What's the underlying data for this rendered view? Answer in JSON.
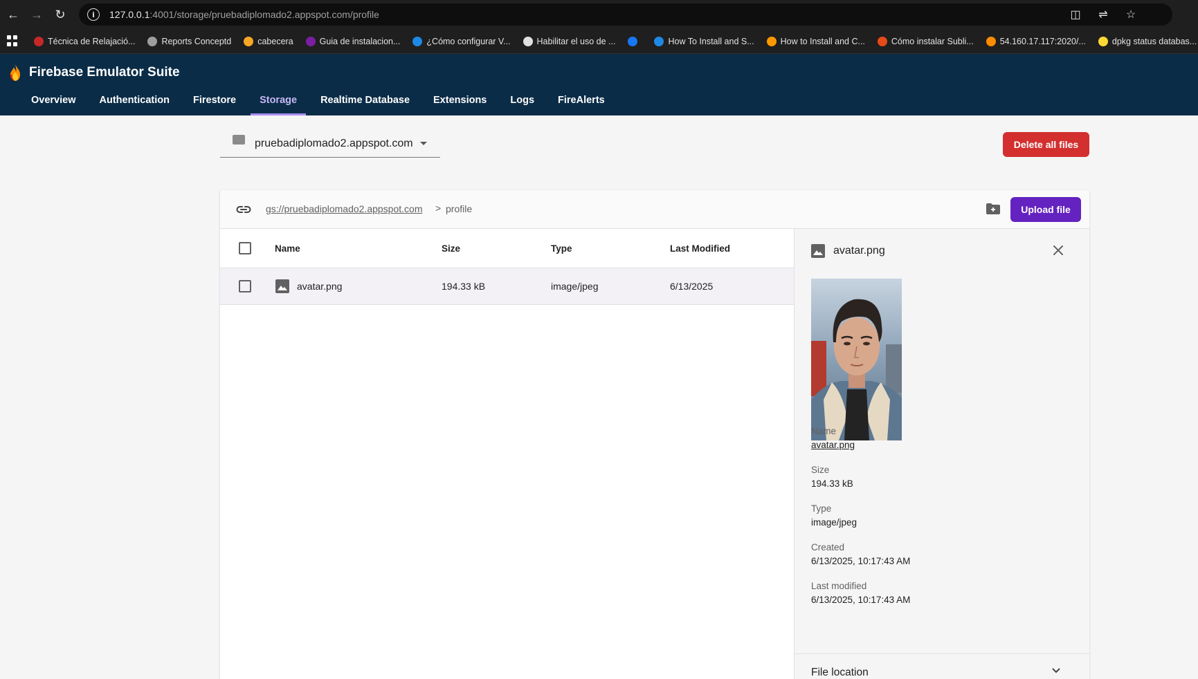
{
  "browser": {
    "url_host": "127.0.0.1",
    "url_rest": ":4001/storage/pruebadiplomado2.appspot.com/profile",
    "bookmarks": [
      {
        "label": "Técnica de Relajació...",
        "color": "#c62828"
      },
      {
        "label": "Reports Conceptd",
        "color": "#9e9e9e"
      },
      {
        "label": "cabecera",
        "color": "#f9a825"
      },
      {
        "label": "Guia de instalacion...",
        "color": "#7b1fa2"
      },
      {
        "label": "¿Cómo configurar V...",
        "color": "#1e88e5"
      },
      {
        "label": "Habilitar el uso de ...",
        "color": "#e0e0e0"
      },
      {
        "label": "",
        "color": "#1877f2"
      },
      {
        "label": "How To Install and S...",
        "color": "#1e88e5"
      },
      {
        "label": "How to Install and C...",
        "color": "#ff9800"
      },
      {
        "label": "Cómo instalar Subli...",
        "color": "#e64a19"
      },
      {
        "label": "54.160.17.117:2020/...",
        "color": "#fb8c00"
      },
      {
        "label": "dpkg status databas...",
        "color": "#fdd835"
      }
    ]
  },
  "app": {
    "title": "Firebase Emulator Suite",
    "tabs": [
      "Overview",
      "Authentication",
      "Firestore",
      "Storage",
      "Realtime Database",
      "Extensions",
      "Logs",
      "FireAlerts"
    ],
    "active_tab": "Storage"
  },
  "storage": {
    "bucket": "pruebadiplomado2.appspot.com",
    "delete_all_label": "Delete all files",
    "breadcrumb_root": "gs://pruebadiplomado2.appspot.com",
    "breadcrumb_sep": ">",
    "breadcrumb_current": "profile",
    "upload_label": "Upload file",
    "columns": [
      "Name",
      "Size",
      "Type",
      "Last Modified"
    ],
    "files": [
      {
        "name": "avatar.png",
        "size": "194.33 kB",
        "type": "image/jpeg",
        "modified": "6/13/2025"
      }
    ]
  },
  "details": {
    "title": "avatar.png",
    "name_label": "Name",
    "name_value": "avatar.png",
    "size_label": "Size",
    "size_value": "194.33 kB",
    "type_label": "Type",
    "type_value": "image/jpeg",
    "created_label": "Created",
    "created_value": "6/13/2025, 10:17:43 AM",
    "modified_label": "Last modified",
    "modified_value": "6/13/2025, 10:17:43 AM",
    "file_location_label": "File location"
  },
  "colors": {
    "appbar": "#0a2c47",
    "accent": "#6422c0",
    "danger": "#d32f2f"
  }
}
